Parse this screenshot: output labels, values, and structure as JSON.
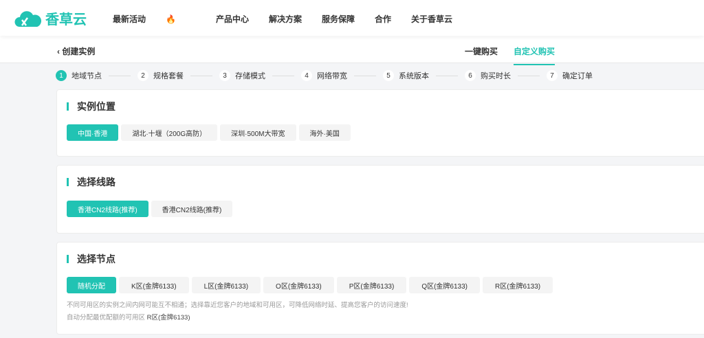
{
  "header": {
    "logo": "香草云",
    "nav": [
      "最新活动",
      "产品中心",
      "解决方案",
      "服务保障",
      "合作",
      "关于香草云"
    ]
  },
  "subbar": {
    "back": "创建实例",
    "tabs": [
      "一键购买",
      "自定义购买"
    ]
  },
  "steps": [
    {
      "n": "1",
      "label": "地域节点"
    },
    {
      "n": "2",
      "label": "规格套餐"
    },
    {
      "n": "3",
      "label": "存储模式"
    },
    {
      "n": "4",
      "label": "网络带宽"
    },
    {
      "n": "5",
      "label": "系统版本"
    },
    {
      "n": "6",
      "label": "购买时长"
    },
    {
      "n": "7",
      "label": "确定订单"
    }
  ],
  "location": {
    "title": "实例位置",
    "options": [
      "中国·香港",
      "湖北·十堰（200G高防）",
      "深圳·500M大带宽",
      "海外·美国"
    ]
  },
  "route": {
    "title": "选择线路",
    "options": [
      "香港CN2线路(推荐)",
      "香港CN2线路(推荐)"
    ]
  },
  "node": {
    "title": "选择节点",
    "options": [
      "随机分配",
      "K区(金牌6133)",
      "L区(金牌6133)",
      "O区(金牌6133)",
      "P区(金牌6133)",
      "Q区(金牌6133)",
      "R区(金牌6133)"
    ],
    "hint": "不同可用区的实例之间内网可能互不相通；选择靠近您客户的地域和可用区，可降低网络时延、提高您客户的访问速度!",
    "auto_label": "自动分配最优配额的可用区",
    "auto_value": "R区(金牌6133)"
  },
  "colors": {
    "accent": "#21c3b3"
  }
}
